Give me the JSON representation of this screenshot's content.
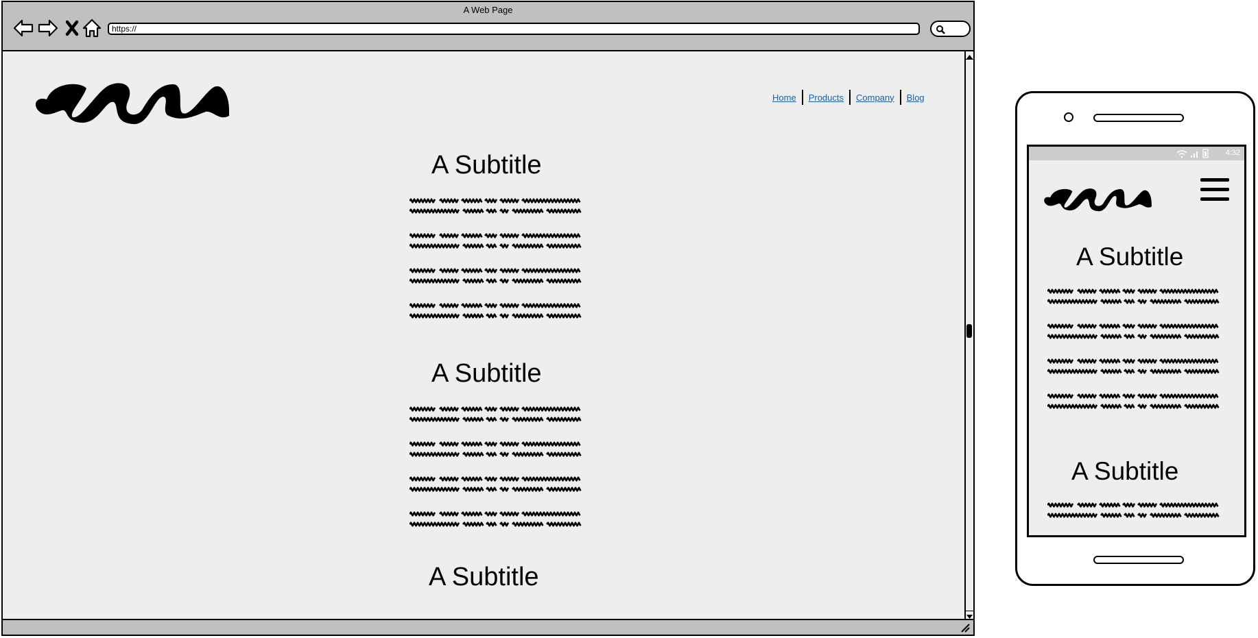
{
  "browser": {
    "title": "A Web Page",
    "url": "https://",
    "icons": {
      "back": "arrow-left-icon",
      "forward": "arrow-right-icon",
      "stop": "close-icon",
      "home": "home-icon",
      "search": "search-icon"
    }
  },
  "site": {
    "nav": [
      {
        "label": "Home"
      },
      {
        "label": "Products"
      },
      {
        "label": "Company"
      },
      {
        "label": "Blog"
      }
    ],
    "sections": [
      {
        "subtitle": "A Subtitle"
      },
      {
        "subtitle": "A Subtitle"
      },
      {
        "subtitle": "A Subtitle"
      }
    ]
  },
  "phone": {
    "time": "4:32",
    "sections": [
      {
        "subtitle": "A Subtitle"
      },
      {
        "subtitle": "A Subtitle"
      }
    ]
  },
  "colors": {
    "chrome": "#c0c0c0",
    "page_background": "#eeeeee",
    "link": "#1a5ea8"
  }
}
